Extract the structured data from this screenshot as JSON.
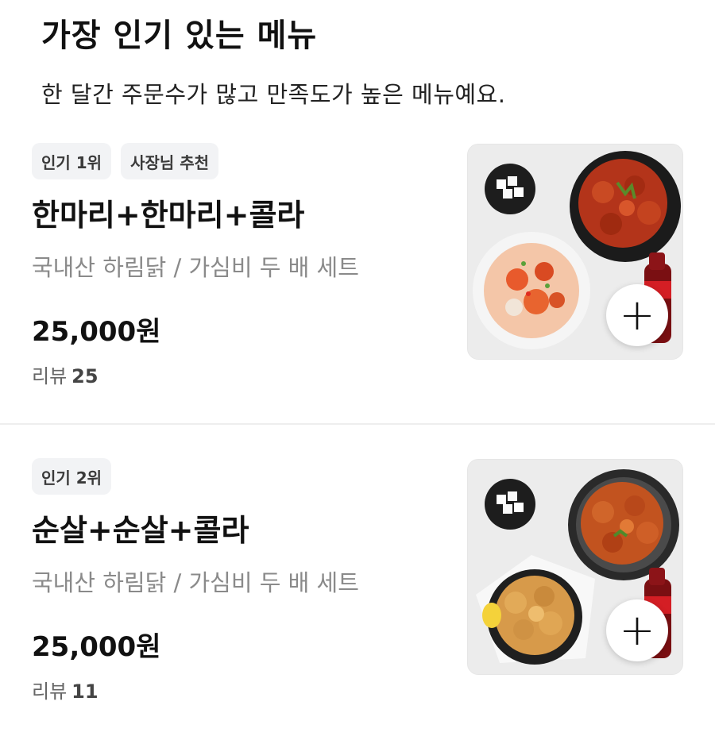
{
  "header": {
    "title": "가장 인기 있는 메뉴",
    "subtitle": "한 달간 주문수가 많고 만족도가 높은 메뉴예요."
  },
  "items": [
    {
      "badges": [
        "인기 1위",
        "사장님 추천"
      ],
      "name": "한마리+한마리+콜라",
      "description": "국내산 하림닭 / 가심비 두 배 세트",
      "price": "25,000원",
      "review_label": "리뷰",
      "review_count": "25",
      "add_icon": "+"
    },
    {
      "badges": [
        "인기 2위"
      ],
      "name": "순살+순살+콜라",
      "description": "국내산 하림닭 / 가심비 두 배 세트",
      "price": "25,000원",
      "review_label": "리뷰",
      "review_count": "11",
      "add_icon": "+"
    }
  ]
}
